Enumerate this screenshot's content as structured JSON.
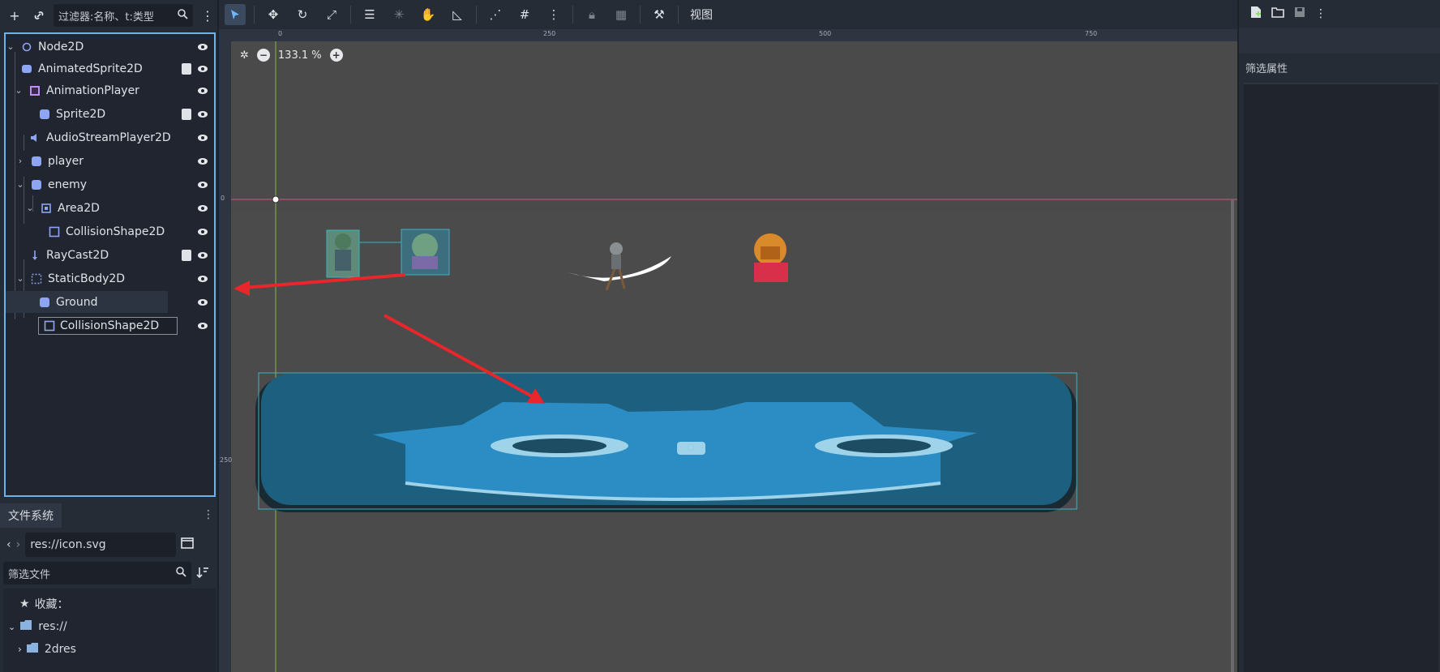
{
  "scene_panel": {
    "filter_placeholder": "过滤器:名称、t:类型",
    "nodes": [
      {
        "label": "Node2D",
        "icon": "node2d-icon"
      },
      {
        "label": "AnimatedSprite2D",
        "icon": "animated-sprite-icon"
      },
      {
        "label": "AnimationPlayer",
        "icon": "animation-player-icon"
      },
      {
        "label": "Sprite2D",
        "icon": "sprite-icon"
      },
      {
        "label": "AudioStreamPlayer2D",
        "icon": "audio-icon"
      },
      {
        "label": "player",
        "icon": "sprite-icon"
      },
      {
        "label": "enemy",
        "icon": "sprite-icon"
      },
      {
        "label": "Area2D",
        "icon": "area-icon"
      },
      {
        "label": "CollisionShape2D",
        "icon": "collision-icon"
      },
      {
        "label": "RayCast2D",
        "icon": "raycast-icon"
      },
      {
        "label": "StaticBody2D",
        "icon": "staticbody-icon"
      },
      {
        "label": "Ground",
        "icon": "sprite-icon"
      },
      {
        "label": "CollisionShape2D",
        "icon": "collision-icon"
      }
    ]
  },
  "filesystem": {
    "tab_label": "文件系统",
    "path": "res://icon.svg",
    "filter_placeholder": "筛选文件",
    "favorites": "收藏：",
    "root": "res://",
    "folder_2dres": "2dres"
  },
  "viewport": {
    "zoom": "133.1 %",
    "view_menu": "视图",
    "ruler_top": [
      "0",
      "250",
      "500",
      "750"
    ],
    "ruler_left": [
      "0",
      "250"
    ]
  },
  "inspector": {
    "filter_label": "筛选属性"
  },
  "colors": {
    "accent": "#6fb2e8",
    "viewport_bg": "#4b4b4b",
    "arrow": "#e8262b",
    "godot_blue": "#2b8dc4"
  }
}
